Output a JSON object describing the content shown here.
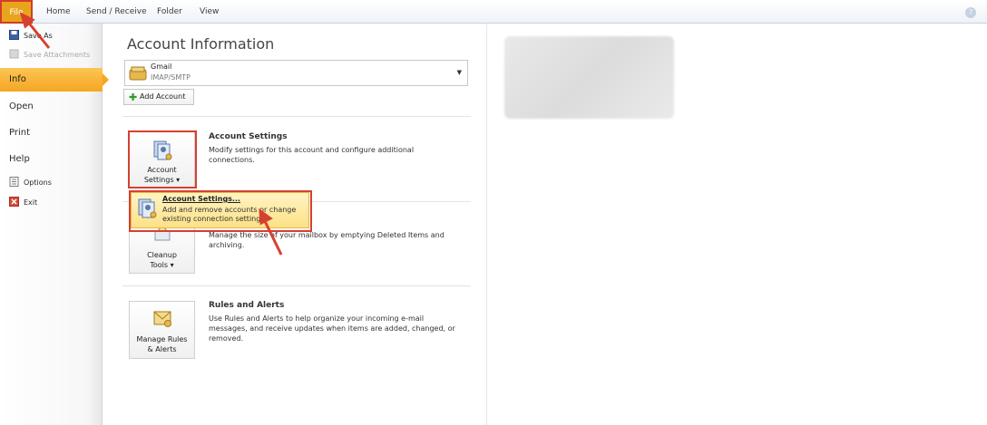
{
  "ribbon": {
    "file": "File",
    "tabs": [
      "Home",
      "Send / Receive",
      "Folder",
      "View"
    ],
    "help": "?"
  },
  "nav": {
    "save_as": "Save As",
    "save_attachments": "Save Attachments",
    "info": "Info",
    "open": "Open",
    "print": "Print",
    "help": "Help",
    "options": "Options",
    "exit": "Exit"
  },
  "main": {
    "title": "Account Information",
    "account": {
      "name": "Gmail",
      "type": "IMAP/SMTP"
    },
    "add_account": "Add Account",
    "account_settings": {
      "button_line1": "Account",
      "button_line2": "Settings ▾",
      "title": "Account Settings",
      "desc": "Modify settings for this account and configure additional connections."
    },
    "dropdown": {
      "title": "Account Settings...",
      "desc": "Add and remove accounts or change existing connection settings."
    },
    "cleanup": {
      "button_line1": "Cleanup",
      "button_line2": "Tools ▾",
      "desc": "Manage the size of your mailbox by emptying Deleted Items and archiving."
    },
    "rules": {
      "button_line1": "Manage Rules",
      "button_line2": "& Alerts",
      "title": "Rules and Alerts",
      "desc": "Use Rules and Alerts to help organize your incoming e-mail messages, and receive updates when items are added, changed, or removed."
    }
  },
  "colors": {
    "accent": "#f5a623",
    "highlight": "#d6402f"
  }
}
